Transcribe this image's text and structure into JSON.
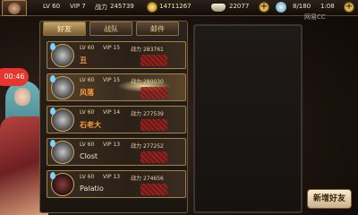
{
  "topbar": {
    "level": "LV 60",
    "vip": "VIP 7",
    "power_label": "战力",
    "power_value": "245739",
    "coins": "14711267",
    "ingots": "22077",
    "stamina": "8/180",
    "time": "1:08"
  },
  "watermark": "网易CC",
  "timer": "00:46",
  "tabs": [
    {
      "label": "好友",
      "active": true
    },
    {
      "label": "战队",
      "active": false
    },
    {
      "label": "邮件",
      "active": false
    }
  ],
  "friends": [
    {
      "level": "LV 60",
      "vip": "VIP 15",
      "power_label": "战力",
      "power": "283761",
      "name": "丑",
      "selected": false
    },
    {
      "level": "LV 60",
      "vip": "VIP 15",
      "power_label": "战力",
      "power": "280030",
      "name": "风落",
      "selected": true
    },
    {
      "level": "LV 60",
      "vip": "VIP 14",
      "power_label": "战力",
      "power": "277539",
      "name": "石老大",
      "selected": false
    },
    {
      "level": "LV 60",
      "vip": "VIP 13",
      "power_label": "战力",
      "power": "277252",
      "name": "Clost",
      "selected": false
    },
    {
      "level": "LV 60",
      "vip": "VIP 13",
      "power_label": "战力",
      "power": "274656",
      "name": "Palatio",
      "selected": false
    }
  ],
  "add_friend_label": "新增好友"
}
